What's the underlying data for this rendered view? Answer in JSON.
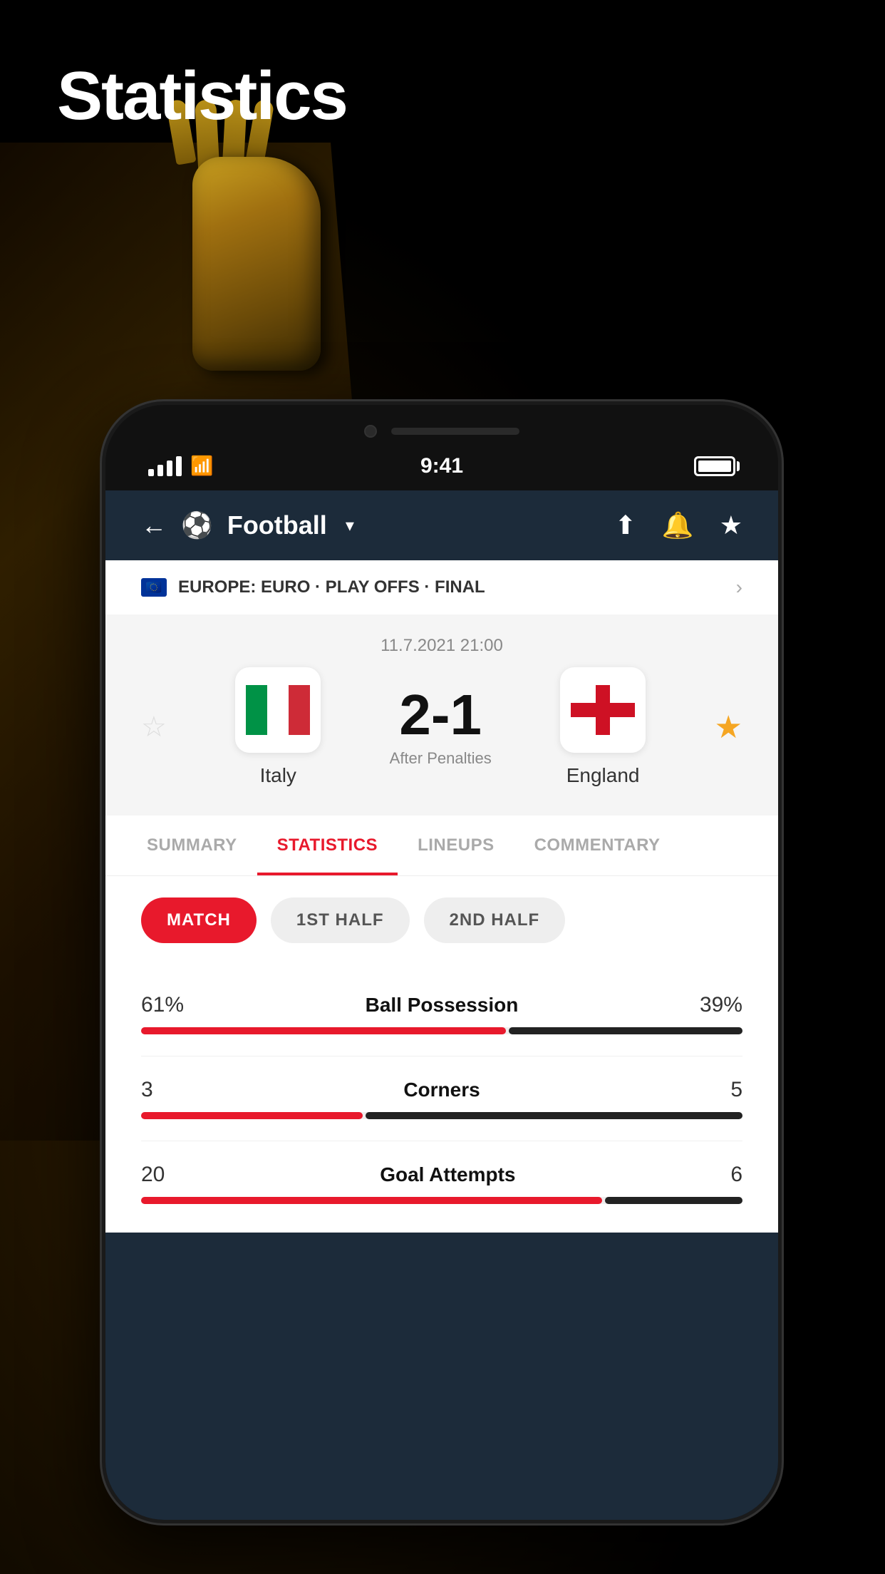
{
  "page": {
    "title": "Statistics"
  },
  "status_bar": {
    "time": "9:41",
    "signal": "signal",
    "wifi": "wifi",
    "battery": "battery"
  },
  "nav": {
    "back_label": "←",
    "sport_icon": "⚽",
    "title": "Football",
    "dropdown_icon": "▾",
    "share_icon": "↑",
    "bell_icon": "🔔",
    "star_icon": "★"
  },
  "competition": {
    "flag": "🇪🇺",
    "text_plain": "EUROPE: ",
    "text_bold": "EURO · PLAY OFFS · FINAL",
    "chevron": "›"
  },
  "match": {
    "date": "11.7.2021 21:00",
    "score": "2-1",
    "score_note": "After Penalties",
    "team_home": "Italy",
    "team_away": "England",
    "star_fav": "☆",
    "star_gold": "★"
  },
  "tabs": [
    {
      "label": "SUMMARY",
      "active": false
    },
    {
      "label": "STATISTICS",
      "active": true
    },
    {
      "label": "LINEUPS",
      "active": false
    },
    {
      "label": "COMMENTARY",
      "active": false
    }
  ],
  "filters": [
    {
      "label": "MATCH",
      "active": true
    },
    {
      "label": "1ST HALF",
      "active": false
    },
    {
      "label": "2ND HALF",
      "active": false
    }
  ],
  "stats": [
    {
      "name": "Ball Possession",
      "left_value": "61%",
      "right_value": "39%",
      "left_pct": 61,
      "right_pct": 39
    },
    {
      "name": "Corners",
      "left_value": "3",
      "right_value": "5",
      "left_pct": 37,
      "right_pct": 63
    },
    {
      "name": "Goal Attempts",
      "left_value": "20",
      "right_value": "6",
      "left_pct": 77,
      "right_pct": 23
    }
  ],
  "colors": {
    "accent": "#e8192c",
    "dark": "#1c2b3a",
    "bar_dark": "#222222"
  }
}
